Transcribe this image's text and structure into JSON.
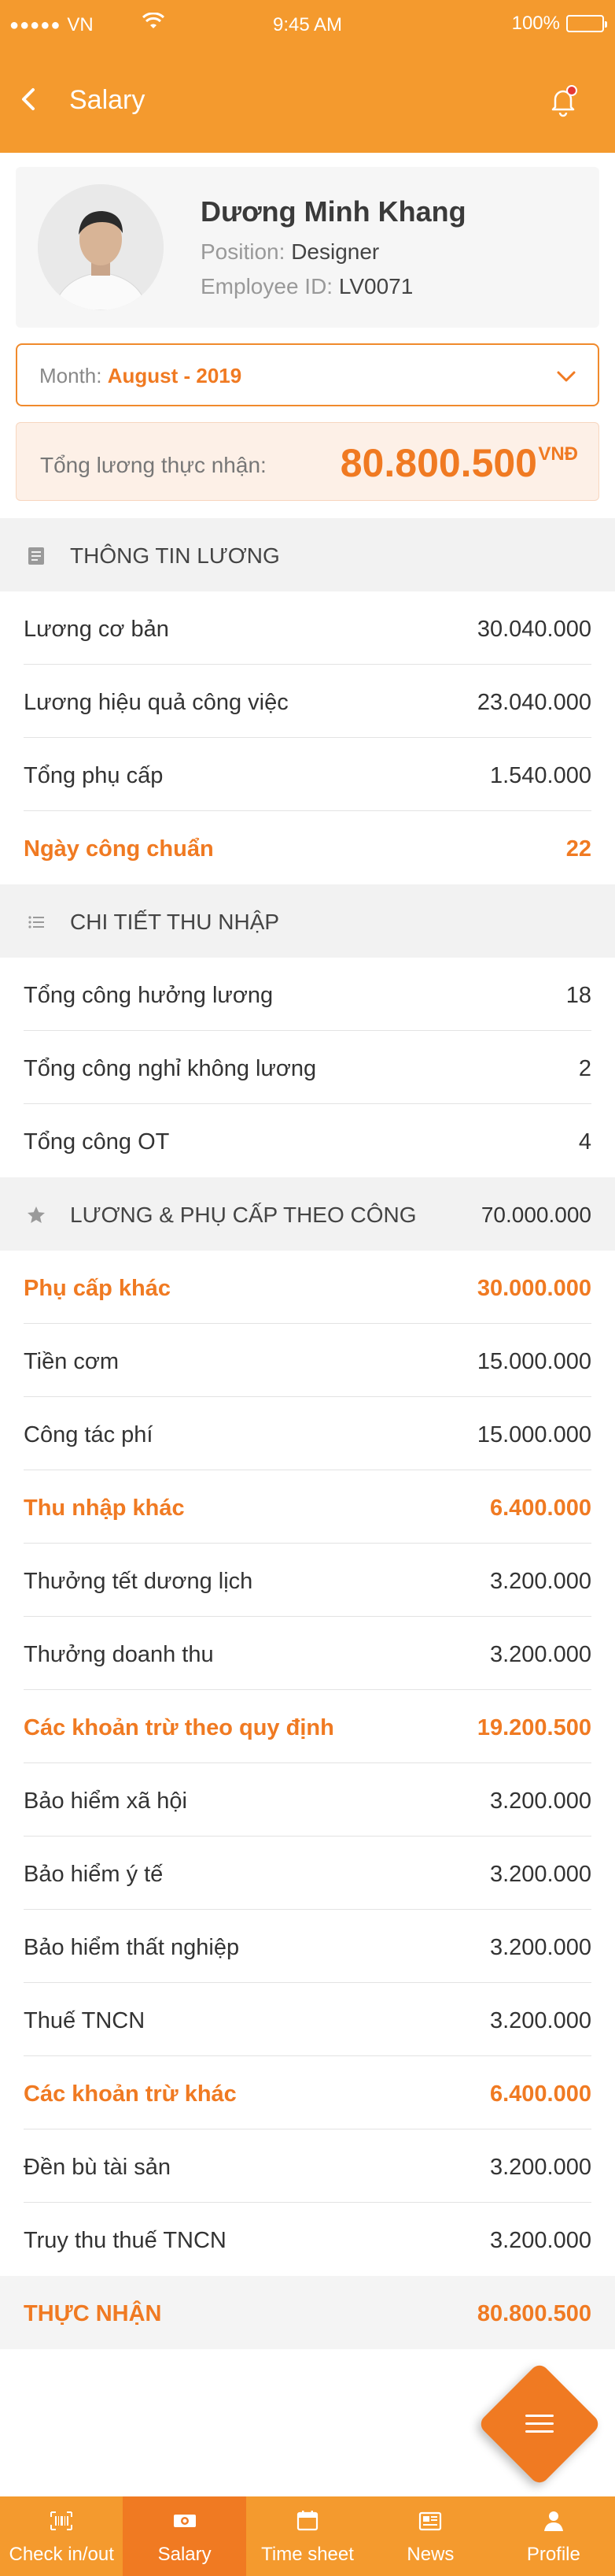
{
  "status_bar": {
    "carrier": "VN",
    "time": "9:45 AM",
    "battery": "100%"
  },
  "header": {
    "title": "Salary"
  },
  "profile": {
    "name": "Dương Minh Khang",
    "position_label": "Position:",
    "position": "Designer",
    "employee_id_label": "Employee ID:",
    "employee_id": "LV0071"
  },
  "month": {
    "label": "Month:",
    "value": "August - 2019"
  },
  "total": {
    "label": "Tổng lương thực nhận:",
    "amount": "80.800.500",
    "currency": "VNĐ"
  },
  "sections": {
    "salary_info": {
      "title": "THÔNG TIN LƯƠNG",
      "rows": [
        {
          "label": "Lương cơ bản",
          "value": "30.040.000"
        },
        {
          "label": "Lương hiệu quả công việc",
          "value": "23.040.000"
        },
        {
          "label": "Tổng phụ cấp",
          "value": "1.540.000"
        },
        {
          "label": "Ngày công chuẩn",
          "value": "22"
        }
      ]
    },
    "income_detail": {
      "title": "CHI TIẾT THU NHẬP",
      "rows": [
        {
          "label": "Tổng công hưởng lương",
          "value": "18"
        },
        {
          "label": "Tổng công nghỉ không lương",
          "value": "2"
        },
        {
          "label": "Tổng công OT",
          "value": "4"
        }
      ]
    },
    "allowance": {
      "title": "LƯƠNG & PHỤ CẤP THEO CÔNG",
      "value": "70.000.000",
      "rows": [
        {
          "label": "Phụ cấp khác",
          "value": "30.000.000"
        },
        {
          "label": "Tiền cơm",
          "value": "15.000.000"
        },
        {
          "label": "Công tác phí",
          "value": "15.000.000"
        },
        {
          "label": "Thu nhập khác",
          "value": "6.400.000"
        },
        {
          "label": "Thưởng tết dương lịch",
          "value": "3.200.000"
        },
        {
          "label": "Thưởng doanh thu",
          "value": "3.200.000"
        },
        {
          "label": "Các khoản trừ theo quy định",
          "value": "19.200.500"
        },
        {
          "label": "Bảo hiểm xã hội",
          "value": "3.200.000"
        },
        {
          "label": "Bảo hiểm ý tế",
          "value": "3.200.000"
        },
        {
          "label": "Bảo hiểm thất nghiệp",
          "value": "3.200.000"
        },
        {
          "label": "Thuế TNCN",
          "value": "3.200.000"
        },
        {
          "label": "Các khoản trừ khác",
          "value": "6.400.000"
        },
        {
          "label": "Đền bù tài sản",
          "value": "3.200.000"
        },
        {
          "label": "Truy thu thuế TNCN",
          "value": "3.200.000"
        }
      ]
    }
  },
  "net": {
    "label": "THỰC NHẬN",
    "value": "80.800.500"
  },
  "tabs": [
    {
      "label": "Check in/out",
      "icon": "barcode-icon"
    },
    {
      "label": "Salary",
      "icon": "money-icon"
    },
    {
      "label": "Time sheet",
      "icon": "calendar-icon"
    },
    {
      "label": "News",
      "icon": "newspaper-icon"
    },
    {
      "label": "Profile",
      "icon": "user-icon"
    }
  ],
  "colors": {
    "primary": "#f49a2e",
    "accent": "#f07a22",
    "highlight_bg": "#fdf0e7"
  }
}
